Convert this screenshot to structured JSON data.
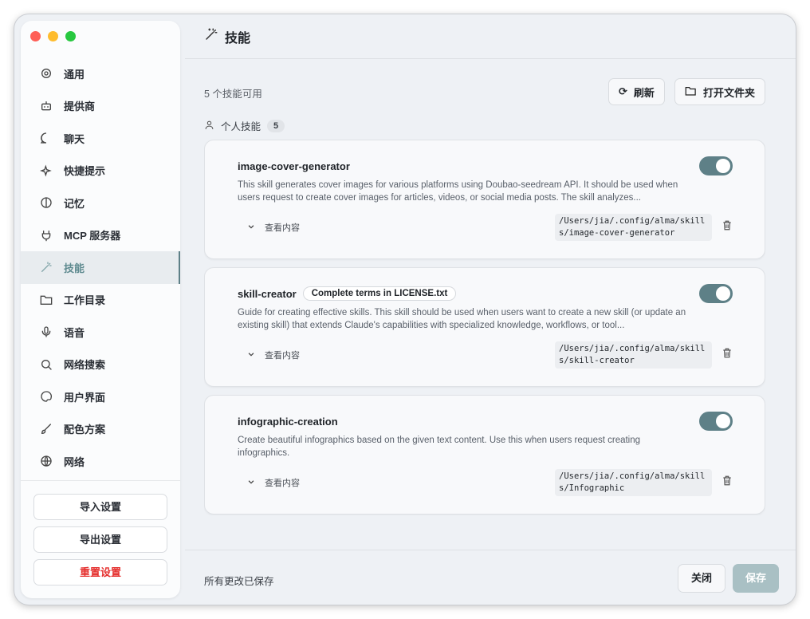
{
  "window": {
    "lights": {
      "close": "#fe5f57",
      "minimize": "#febc2e",
      "zoom": "#28c840"
    }
  },
  "sidebar": {
    "items": [
      {
        "label": "通用",
        "icon": "gear-icon"
      },
      {
        "label": "提供商",
        "icon": "bot-icon"
      },
      {
        "label": "聊天",
        "icon": "chat-bubble-icon"
      },
      {
        "label": "快捷提示",
        "icon": "sparkles-icon"
      },
      {
        "label": "记忆",
        "icon": "brain-icon"
      },
      {
        "label": "MCP 服务器",
        "icon": "plug-icon"
      },
      {
        "label": "技能",
        "icon": "magic-wand-icon",
        "active": true
      },
      {
        "label": "工作目录",
        "icon": "folder-icon"
      },
      {
        "label": "语音",
        "icon": "microphone-icon"
      },
      {
        "label": "网络搜索",
        "icon": "search-icon"
      },
      {
        "label": "用户界面",
        "icon": "palette-icon"
      },
      {
        "label": "配色方案",
        "icon": "brush-icon"
      },
      {
        "label": "网络",
        "icon": "globe-icon"
      }
    ],
    "import_label": "导入设置",
    "export_label": "导出设置",
    "reset_label": "重置设置"
  },
  "header": {
    "title": "技能"
  },
  "toolbar": {
    "available": "5 个技能可用",
    "refresh_label": "刷新",
    "open_folder_label": "打开文件夹"
  },
  "section": {
    "label": "个人技能",
    "count": "5"
  },
  "skills": [
    {
      "name": "image-cover-generator",
      "badge": "",
      "description": "This skill generates cover images for various platforms using Doubao-seedream API. It should be used when users request to create cover images for articles, videos, or social media posts. The skill analyzes...",
      "view_label": "查看内容",
      "path": "/Users/jia/.config/alma/skills/image-cover-generator",
      "enabled": true
    },
    {
      "name": "skill-creator",
      "badge": "Complete terms in LICENSE.txt",
      "description": "Guide for creating effective skills. This skill should be used when users want to create a new skill (or update an existing skill) that extends Claude's capabilities with specialized knowledge, workflows, or tool...",
      "view_label": "查看内容",
      "path": "/Users/jia/.config/alma/skills/skill-creator",
      "enabled": true
    },
    {
      "name": "infographic-creation",
      "badge": "",
      "description": "Create beautiful infographics based on the given text content. Use this when users request creating infographics.",
      "view_label": "查看内容",
      "path": "/Users/jia/.config/alma/skills/Infographic",
      "enabled": true
    }
  ],
  "footer": {
    "status": "所有更改已保存",
    "close_label": "关闭",
    "save_label": "保存"
  },
  "colors": {
    "accent": "#5e8087",
    "danger": "#e5312f",
    "save_disabled": "#a9c0c4"
  }
}
